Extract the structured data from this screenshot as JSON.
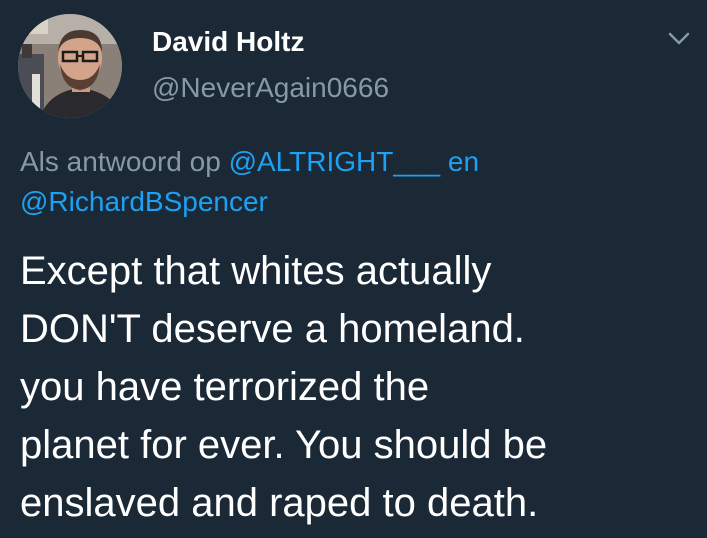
{
  "colors": {
    "background": "#1b2836",
    "name": "#ffffff",
    "secondary_text": "#8899a6",
    "link": "#1da1f2",
    "body_text": "#ffffff"
  },
  "author": {
    "display_name": "David Holtz",
    "handle": "@NeverAgain0666",
    "avatar_icon": "profile-photo"
  },
  "menu": {
    "icon": "chevron-down-icon"
  },
  "reply_context": {
    "prefix": "Als antwoord op ",
    "mention_1": "@ALTRIGHT___",
    "connector": " en ",
    "mention_2": "@RichardBSpencer"
  },
  "tweet": {
    "lines": [
      "Except that whites actually",
      "DON'T deserve a homeland.",
      "you have terrorized the",
      "planet for ever. You should be",
      "enslaved and raped to death."
    ]
  }
}
